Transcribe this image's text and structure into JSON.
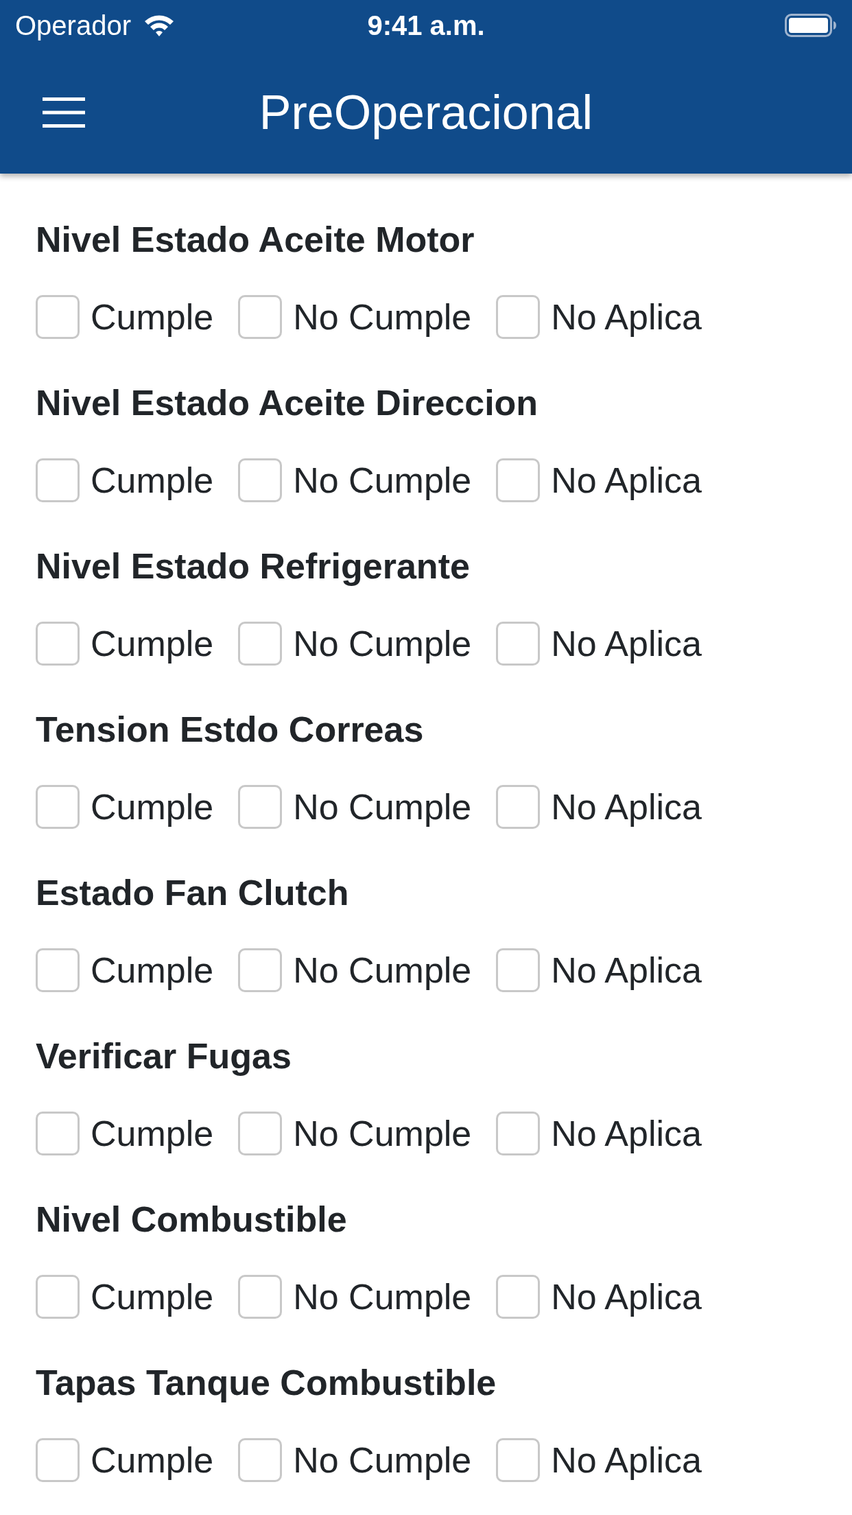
{
  "status_bar": {
    "carrier": "Operador",
    "time": "9:41 a.m."
  },
  "nav_bar": {
    "title": "PreOperacional"
  },
  "items": [
    {
      "label": "Nivel Estado Aceite Motor",
      "options": [
        {
          "label": "Cumple",
          "checked": false
        },
        {
          "label": "No Cumple",
          "checked": false
        },
        {
          "label": "No Aplica",
          "checked": false
        }
      ]
    },
    {
      "label": "Nivel Estado Aceite Direccion",
      "options": [
        {
          "label": "Cumple",
          "checked": false
        },
        {
          "label": "No Cumple",
          "checked": false
        },
        {
          "label": "No Aplica",
          "checked": false
        }
      ]
    },
    {
      "label": "Nivel Estado Refrigerante",
      "options": [
        {
          "label": "Cumple",
          "checked": false
        },
        {
          "label": "No Cumple",
          "checked": false
        },
        {
          "label": "No Aplica",
          "checked": false
        }
      ]
    },
    {
      "label": "Tension Estdo Correas",
      "options": [
        {
          "label": "Cumple",
          "checked": false
        },
        {
          "label": "No Cumple",
          "checked": false
        },
        {
          "label": "No Aplica",
          "checked": false
        }
      ]
    },
    {
      "label": "Estado Fan Clutch",
      "options": [
        {
          "label": "Cumple",
          "checked": false
        },
        {
          "label": "No Cumple",
          "checked": false
        },
        {
          "label": "No Aplica",
          "checked": false
        }
      ]
    },
    {
      "label": "Verificar Fugas",
      "options": [
        {
          "label": "Cumple",
          "checked": false
        },
        {
          "label": "No Cumple",
          "checked": false
        },
        {
          "label": "No Aplica",
          "checked": false
        }
      ]
    },
    {
      "label": "Nivel Combustible",
      "options": [
        {
          "label": "Cumple",
          "checked": false
        },
        {
          "label": "No Cumple",
          "checked": false
        },
        {
          "label": "No Aplica",
          "checked": false
        }
      ]
    },
    {
      "label": "Tapas Tanque Combustible",
      "options": [
        {
          "label": "Cumple",
          "checked": false
        },
        {
          "label": "No Cumple",
          "checked": false
        },
        {
          "label": "No Aplica",
          "checked": false
        }
      ]
    }
  ]
}
